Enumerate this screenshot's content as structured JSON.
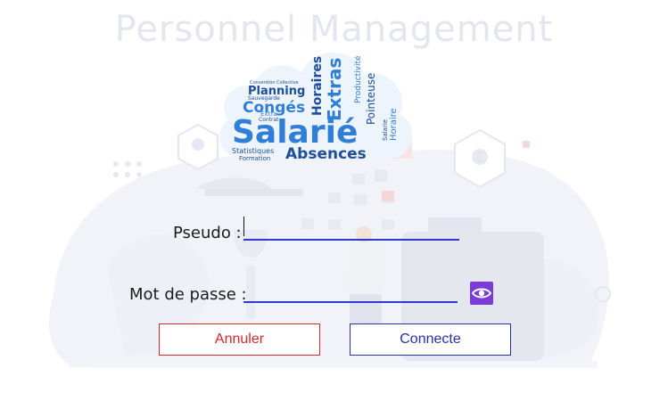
{
  "header": {
    "title": "Personnel Management"
  },
  "logo": {
    "words": [
      "Salarié",
      "Absences",
      "Congés",
      "Planning",
      "Extras",
      "Horaires",
      "Pointeuse",
      "Productivité",
      "Statistiques",
      "Formation",
      "Sauvegarde",
      "Convention Collective",
      "Contrat",
      "Extra",
      "Salarie",
      "Horaire"
    ]
  },
  "form": {
    "pseudo_label": "Pseudo :",
    "pseudo_value": "",
    "password_label": "Mot de passe :",
    "password_value": "",
    "show_password_icon": "eye-icon"
  },
  "buttons": {
    "cancel_label": "Annuler",
    "connect_label": "Connecte"
  },
  "colors": {
    "title": "#e3e6ef",
    "input_underline": "#2b3bd2",
    "cancel": "#d42a2a",
    "connect": "#2433a8",
    "eye_button": "#7a3bd6",
    "logo_blue": "#2f7fd8",
    "logo_dark": "#1f4e9a"
  }
}
